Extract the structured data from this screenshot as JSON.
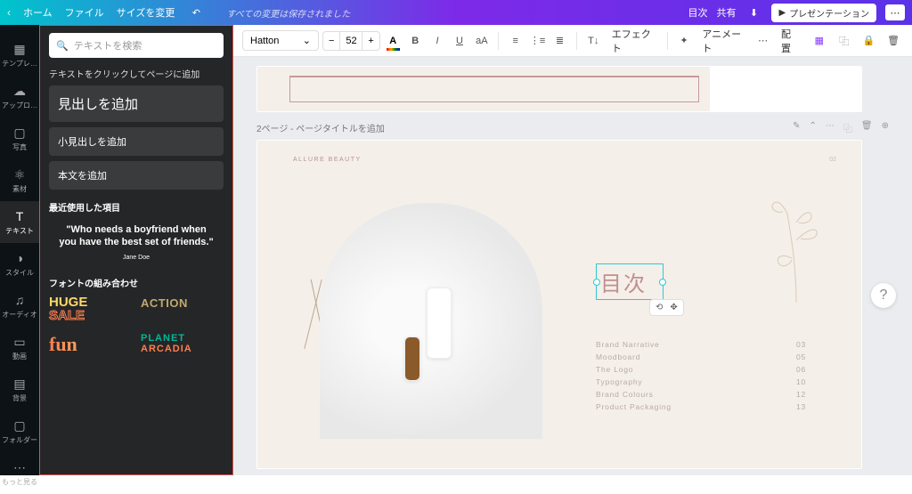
{
  "topbar": {
    "home": "ホーム",
    "file": "ファイル",
    "resize": "サイズを変更",
    "saved": "すべての変更は保存されました",
    "toc": "目次",
    "share": "共有",
    "present": "プレゼンテーション"
  },
  "rail": {
    "items": [
      {
        "label": "テンプレ…"
      },
      {
        "label": "アップロ…"
      },
      {
        "label": "写真"
      },
      {
        "label": "素材"
      },
      {
        "label": "テキスト"
      },
      {
        "label": "スタイル"
      },
      {
        "label": "オーディオ"
      },
      {
        "label": "動画"
      },
      {
        "label": "背景"
      },
      {
        "label": "フォルダー"
      },
      {
        "label": "もっと見る"
      }
    ]
  },
  "panel": {
    "search_placeholder": "テキストを検索",
    "click_hint": "テキストをクリックしてページに追加",
    "add_heading": "見出しを追加",
    "add_subheading": "小見出しを追加",
    "add_body": "本文を追加",
    "recent": "最近使用した項目",
    "quote_text": "\"Who needs a boyfriend when you have the best set of friends.\"",
    "quote_author": "Jane Doe",
    "font_combo": "フォントの組み合わせ",
    "huge1": "HUGE",
    "huge2": "SALE",
    "action": "ACTION",
    "fun": "fun",
    "planet1": "PLANET",
    "planet2": "ARCADIA"
  },
  "toolbar": {
    "font": "Hatton",
    "size": "52",
    "effect": "エフェクト",
    "animate": "アニメート",
    "position": "配置"
  },
  "page": {
    "header": "2ページ - ページタイトルを追加",
    "brand": "ALLURE BEAUTY",
    "number": "02",
    "title": "目次",
    "toc": [
      {
        "label": "Brand Narrative",
        "num": "03"
      },
      {
        "label": "Moodboard",
        "num": "05"
      },
      {
        "label": "The Logo",
        "num": "06"
      },
      {
        "label": "Typography",
        "num": "10"
      },
      {
        "label": "Brand Colours",
        "num": "12"
      },
      {
        "label": "Product Packaging",
        "num": "13"
      }
    ]
  }
}
